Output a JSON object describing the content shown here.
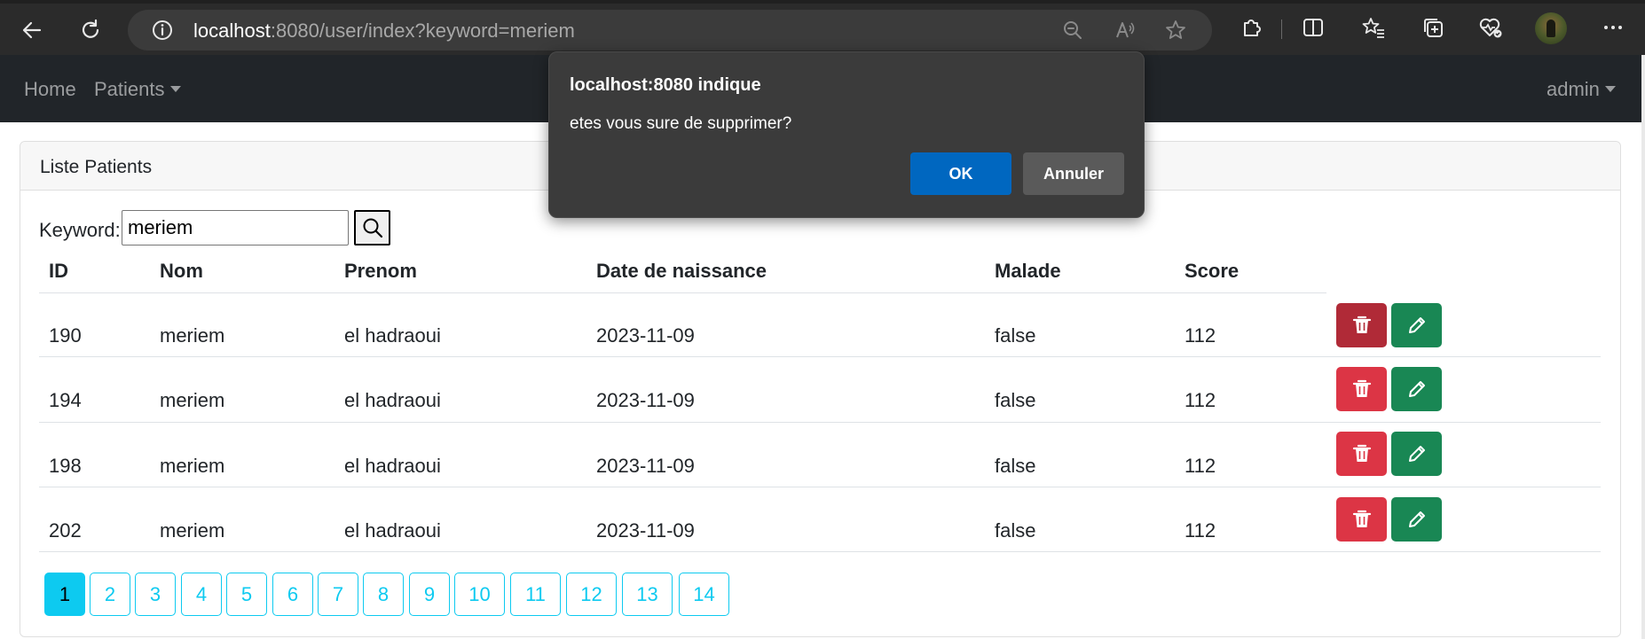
{
  "browser": {
    "url_host": "localhost",
    "url_rest": ":8080/user/index?keyword=meriem"
  },
  "navbar": {
    "home_label": "Home",
    "patients_label": "Patients",
    "user_label": "admin"
  },
  "card": {
    "title": "Liste Patients"
  },
  "search": {
    "label": "Keyword:",
    "value": "meriem"
  },
  "table": {
    "headers": [
      "ID",
      "Nom",
      "Prenom",
      "Date de naissance",
      "Malade",
      "Score"
    ],
    "rows": [
      [
        "190",
        "meriem",
        "el hadraoui",
        "2023-11-09",
        "false",
        "112"
      ],
      [
        "194",
        "meriem",
        "el hadraoui",
        "2023-11-09",
        "false",
        "112"
      ],
      [
        "198",
        "meriem",
        "el hadraoui",
        "2023-11-09",
        "false",
        "112"
      ],
      [
        "202",
        "meriem",
        "el hadraoui",
        "2023-11-09",
        "false",
        "112"
      ]
    ]
  },
  "pagination": {
    "pages": [
      "1",
      "2",
      "3",
      "4",
      "5",
      "6",
      "7",
      "8",
      "9",
      "10",
      "11",
      "12",
      "13",
      "14"
    ],
    "active_page": "1"
  },
  "dialog": {
    "title": "localhost:8080 indique",
    "message": "etes vous sure de supprimer?",
    "ok_label": "OK",
    "cancel_label": "Annuler"
  },
  "colors": {
    "navbar_bg": "#212529",
    "danger": "#dc3545",
    "success": "#198754",
    "info": "#0dcaf0",
    "dialog_ok": "#0067c0"
  }
}
